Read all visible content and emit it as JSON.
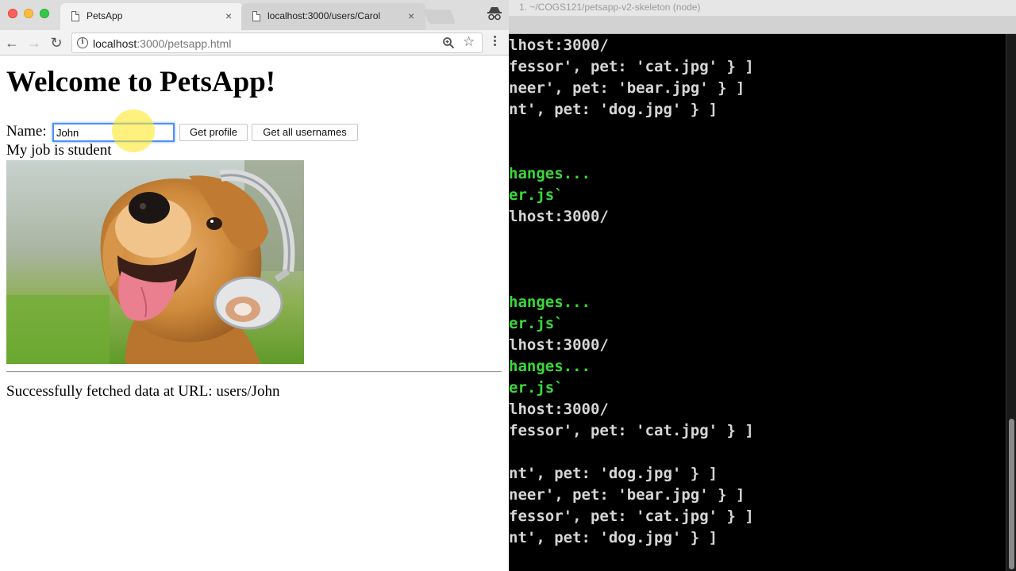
{
  "browser": {
    "tabs": [
      {
        "title": "PetsApp",
        "close": "×"
      },
      {
        "title": "localhost:3000/users/Carol",
        "close": "×"
      }
    ],
    "url_host": "localhost",
    "url_path": ":3000/petsapp.html",
    "nav": {
      "back": "←",
      "forward": "→",
      "reload": "↻"
    },
    "info_icon": "i",
    "star": "☆"
  },
  "page": {
    "heading": "Welcome to PetsApp!",
    "name_label": "Name:",
    "name_value": "John",
    "get_profile": "Get profile",
    "get_all": "Get all usernames",
    "job_text": "My job is student",
    "status": "Successfully fetched data at URL: users/John"
  },
  "terminal": {
    "title": "1. ~/COGS121/petsapp-v2-skeleton (node)",
    "lines": [
      {
        "text": "lhost:3000/",
        "color": "white"
      },
      {
        "text": "fessor', pet: 'cat.jpg' } ]",
        "color": "white"
      },
      {
        "text": "neer', pet: 'bear.jpg' } ]",
        "color": "white"
      },
      {
        "text": "nt', pet: 'dog.jpg' } ]",
        "color": "white"
      },
      {
        "text": "",
        "color": "white"
      },
      {
        "text": "",
        "color": "white"
      },
      {
        "text": "hanges...",
        "color": "green"
      },
      {
        "text": "er.js`",
        "color": "green"
      },
      {
        "text": "lhost:3000/",
        "color": "white"
      },
      {
        "text": "",
        "color": "white"
      },
      {
        "text": "",
        "color": "white"
      },
      {
        "text": "",
        "color": "white"
      },
      {
        "text": "hanges...",
        "color": "green"
      },
      {
        "text": "er.js`",
        "color": "green"
      },
      {
        "text": "lhost:3000/",
        "color": "white"
      },
      {
        "text": "hanges...",
        "color": "green"
      },
      {
        "text": "er.js`",
        "color": "green"
      },
      {
        "text": "lhost:3000/",
        "color": "white"
      },
      {
        "text": "fessor', pet: 'cat.jpg' } ]",
        "color": "white"
      },
      {
        "text": "",
        "color": "white"
      },
      {
        "text": "nt', pet: 'dog.jpg' } ]",
        "color": "white"
      },
      {
        "text": "neer', pet: 'bear.jpg' } ]",
        "color": "white"
      },
      {
        "text": "fessor', pet: 'cat.jpg' } ]",
        "color": "white"
      },
      {
        "text": "nt', pet: 'dog.jpg' } ]",
        "color": "white"
      }
    ]
  }
}
